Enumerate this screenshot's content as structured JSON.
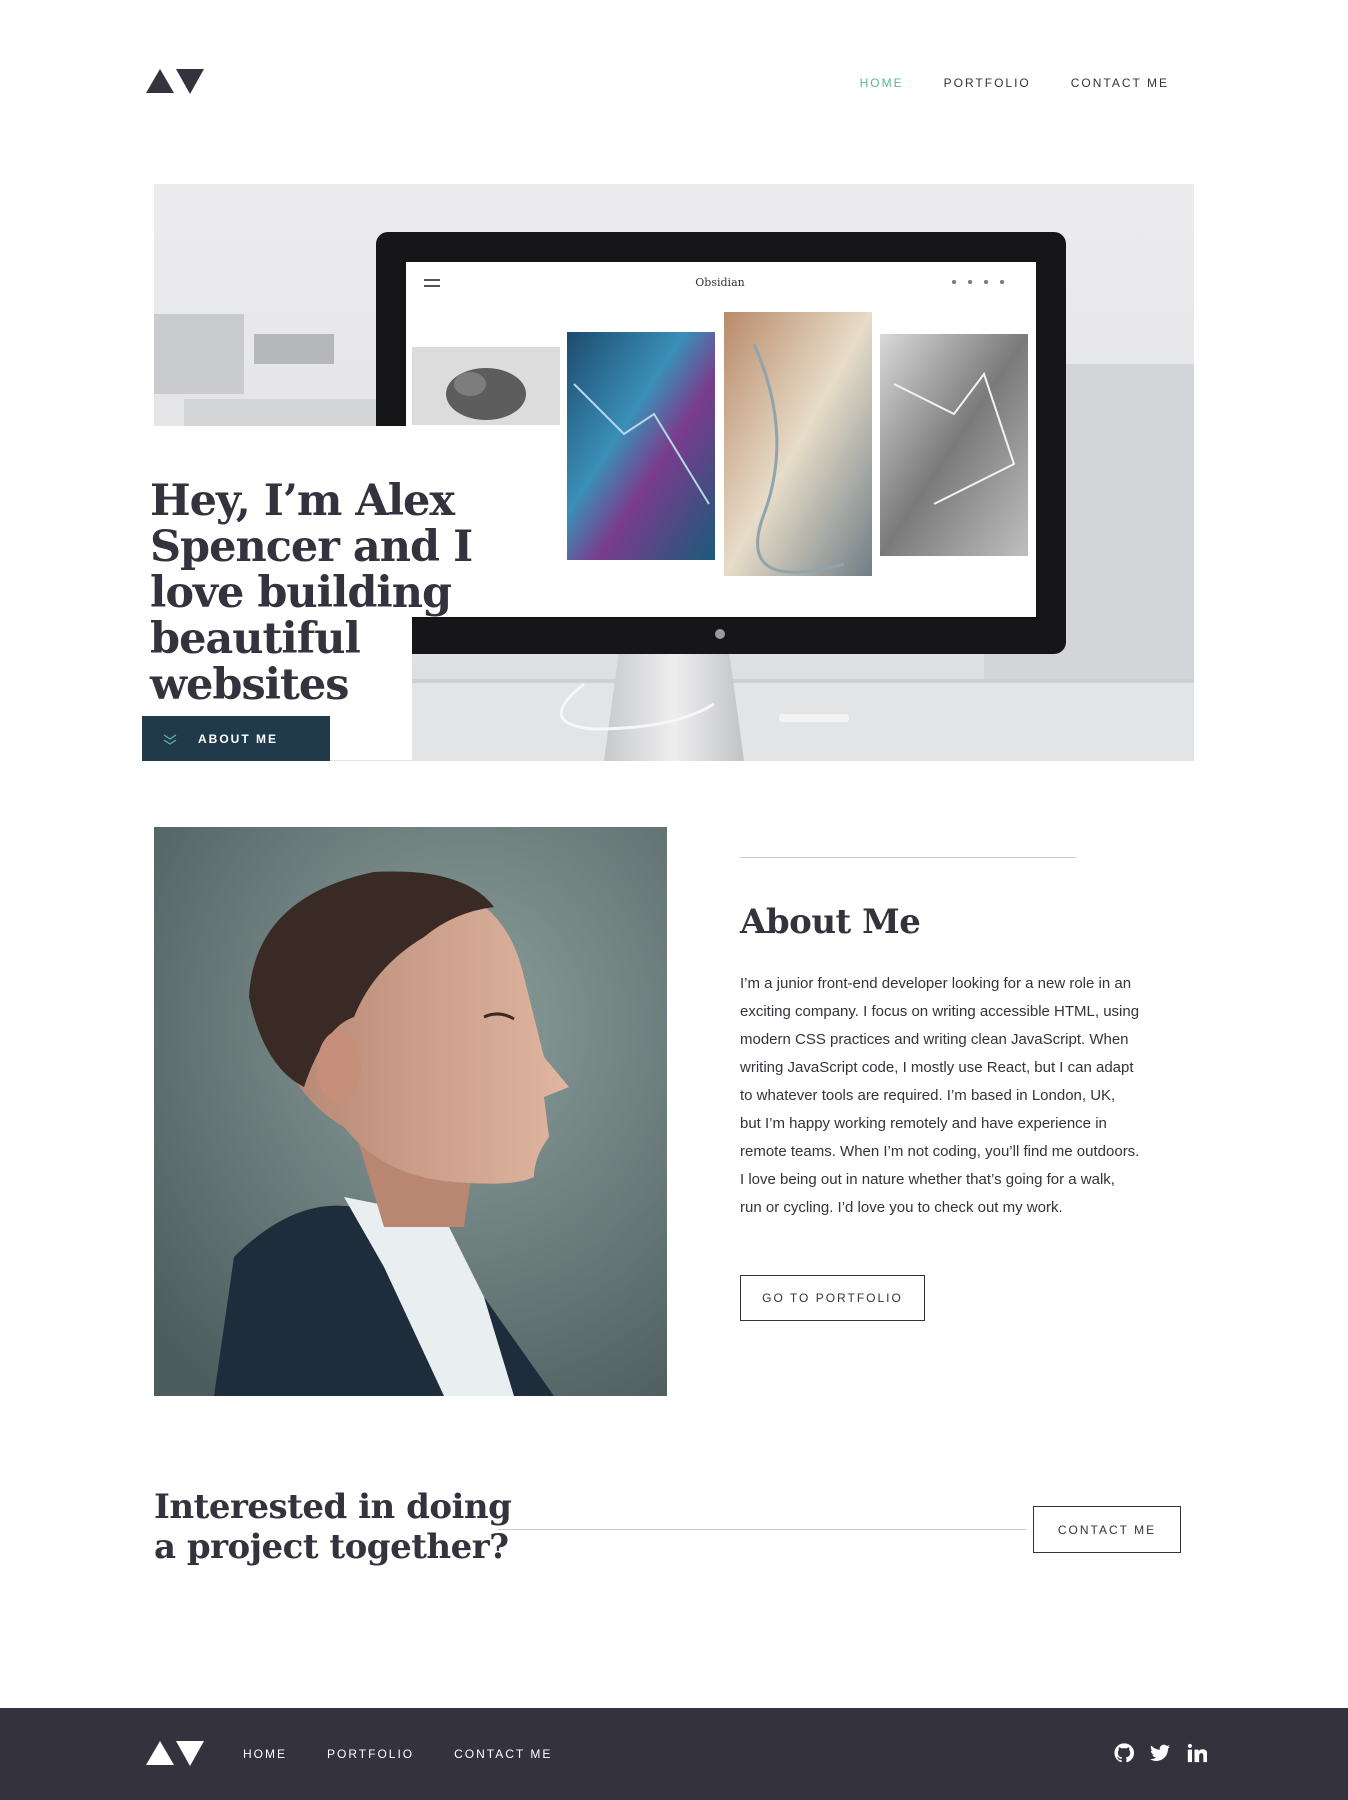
{
  "colors": {
    "dark": "#33323d",
    "accent": "#5fb4a2",
    "button_dark": "#203a4c",
    "footer_bg": "#33323d"
  },
  "header": {
    "logo_icon": "triangle-logo-icon",
    "nav": [
      {
        "label": "HOME",
        "active": true
      },
      {
        "label": "PORTFOLIO",
        "active": false
      },
      {
        "label": "CONTACT ME",
        "active": false
      }
    ]
  },
  "hero": {
    "title": "Hey, I’m Alex Spencer and I love building beautiful websites",
    "button_label": "ABOUT ME",
    "button_icon": "chevrons-down-icon",
    "screen_site_name": "Obsidian"
  },
  "about": {
    "title": "About Me",
    "body": "I’m a junior front-end developer looking for a new role in an exciting company. I focus on writing accessible HTML, using modern CSS practices and writing clean JavaScript. When writing JavaScript code, I mostly use React, but I can adapt to whatever tools are required. I’m based in London, UK, but I’m happy working remotely and have experience in remote teams. When I’m not coding, you’ll find me outdoors. I love being out in nature whether that’s going for a walk, run or cycling. I’d love you to check out my work.",
    "button_label": "GO TO PORTFOLIO"
  },
  "cta": {
    "title": "Interested in doing a project together?",
    "button_label": "CONTACT ME"
  },
  "footer": {
    "nav": [
      "HOME",
      "PORTFOLIO",
      "CONTACT ME"
    ],
    "social_icons": [
      "github-icon",
      "twitter-icon",
      "linkedin-icon"
    ]
  }
}
